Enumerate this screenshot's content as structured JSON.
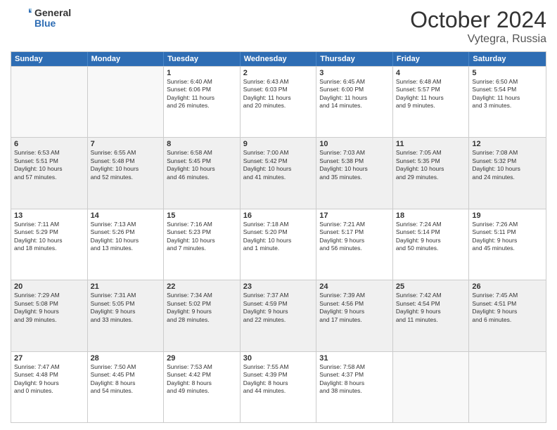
{
  "logo": {
    "general": "General",
    "blue": "Blue"
  },
  "title": "October 2024",
  "location": "Vytegra, Russia",
  "days": [
    "Sunday",
    "Monday",
    "Tuesday",
    "Wednesday",
    "Thursday",
    "Friday",
    "Saturday"
  ],
  "weeks": [
    [
      {
        "num": "",
        "lines": [],
        "empty": true
      },
      {
        "num": "",
        "lines": [],
        "empty": true
      },
      {
        "num": "1",
        "lines": [
          "Sunrise: 6:40 AM",
          "Sunset: 6:06 PM",
          "Daylight: 11 hours",
          "and 26 minutes."
        ]
      },
      {
        "num": "2",
        "lines": [
          "Sunrise: 6:43 AM",
          "Sunset: 6:03 PM",
          "Daylight: 11 hours",
          "and 20 minutes."
        ]
      },
      {
        "num": "3",
        "lines": [
          "Sunrise: 6:45 AM",
          "Sunset: 6:00 PM",
          "Daylight: 11 hours",
          "and 14 minutes."
        ]
      },
      {
        "num": "4",
        "lines": [
          "Sunrise: 6:48 AM",
          "Sunset: 5:57 PM",
          "Daylight: 11 hours",
          "and 9 minutes."
        ]
      },
      {
        "num": "5",
        "lines": [
          "Sunrise: 6:50 AM",
          "Sunset: 5:54 PM",
          "Daylight: 11 hours",
          "and 3 minutes."
        ]
      }
    ],
    [
      {
        "num": "6",
        "lines": [
          "Sunrise: 6:53 AM",
          "Sunset: 5:51 PM",
          "Daylight: 10 hours",
          "and 57 minutes."
        ]
      },
      {
        "num": "7",
        "lines": [
          "Sunrise: 6:55 AM",
          "Sunset: 5:48 PM",
          "Daylight: 10 hours",
          "and 52 minutes."
        ]
      },
      {
        "num": "8",
        "lines": [
          "Sunrise: 6:58 AM",
          "Sunset: 5:45 PM",
          "Daylight: 10 hours",
          "and 46 minutes."
        ]
      },
      {
        "num": "9",
        "lines": [
          "Sunrise: 7:00 AM",
          "Sunset: 5:42 PM",
          "Daylight: 10 hours",
          "and 41 minutes."
        ]
      },
      {
        "num": "10",
        "lines": [
          "Sunrise: 7:03 AM",
          "Sunset: 5:38 PM",
          "Daylight: 10 hours",
          "and 35 minutes."
        ]
      },
      {
        "num": "11",
        "lines": [
          "Sunrise: 7:05 AM",
          "Sunset: 5:35 PM",
          "Daylight: 10 hours",
          "and 29 minutes."
        ]
      },
      {
        "num": "12",
        "lines": [
          "Sunrise: 7:08 AM",
          "Sunset: 5:32 PM",
          "Daylight: 10 hours",
          "and 24 minutes."
        ]
      }
    ],
    [
      {
        "num": "13",
        "lines": [
          "Sunrise: 7:11 AM",
          "Sunset: 5:29 PM",
          "Daylight: 10 hours",
          "and 18 minutes."
        ]
      },
      {
        "num": "14",
        "lines": [
          "Sunrise: 7:13 AM",
          "Sunset: 5:26 PM",
          "Daylight: 10 hours",
          "and 13 minutes."
        ]
      },
      {
        "num": "15",
        "lines": [
          "Sunrise: 7:16 AM",
          "Sunset: 5:23 PM",
          "Daylight: 10 hours",
          "and 7 minutes."
        ]
      },
      {
        "num": "16",
        "lines": [
          "Sunrise: 7:18 AM",
          "Sunset: 5:20 PM",
          "Daylight: 10 hours",
          "and 1 minute."
        ]
      },
      {
        "num": "17",
        "lines": [
          "Sunrise: 7:21 AM",
          "Sunset: 5:17 PM",
          "Daylight: 9 hours",
          "and 56 minutes."
        ]
      },
      {
        "num": "18",
        "lines": [
          "Sunrise: 7:24 AM",
          "Sunset: 5:14 PM",
          "Daylight: 9 hours",
          "and 50 minutes."
        ]
      },
      {
        "num": "19",
        "lines": [
          "Sunrise: 7:26 AM",
          "Sunset: 5:11 PM",
          "Daylight: 9 hours",
          "and 45 minutes."
        ]
      }
    ],
    [
      {
        "num": "20",
        "lines": [
          "Sunrise: 7:29 AM",
          "Sunset: 5:08 PM",
          "Daylight: 9 hours",
          "and 39 minutes."
        ]
      },
      {
        "num": "21",
        "lines": [
          "Sunrise: 7:31 AM",
          "Sunset: 5:05 PM",
          "Daylight: 9 hours",
          "and 33 minutes."
        ]
      },
      {
        "num": "22",
        "lines": [
          "Sunrise: 7:34 AM",
          "Sunset: 5:02 PM",
          "Daylight: 9 hours",
          "and 28 minutes."
        ]
      },
      {
        "num": "23",
        "lines": [
          "Sunrise: 7:37 AM",
          "Sunset: 4:59 PM",
          "Daylight: 9 hours",
          "and 22 minutes."
        ]
      },
      {
        "num": "24",
        "lines": [
          "Sunrise: 7:39 AM",
          "Sunset: 4:56 PM",
          "Daylight: 9 hours",
          "and 17 minutes."
        ]
      },
      {
        "num": "25",
        "lines": [
          "Sunrise: 7:42 AM",
          "Sunset: 4:54 PM",
          "Daylight: 9 hours",
          "and 11 minutes."
        ]
      },
      {
        "num": "26",
        "lines": [
          "Sunrise: 7:45 AM",
          "Sunset: 4:51 PM",
          "Daylight: 9 hours",
          "and 6 minutes."
        ]
      }
    ],
    [
      {
        "num": "27",
        "lines": [
          "Sunrise: 7:47 AM",
          "Sunset: 4:48 PM",
          "Daylight: 9 hours",
          "and 0 minutes."
        ]
      },
      {
        "num": "28",
        "lines": [
          "Sunrise: 7:50 AM",
          "Sunset: 4:45 PM",
          "Daylight: 8 hours",
          "and 54 minutes."
        ]
      },
      {
        "num": "29",
        "lines": [
          "Sunrise: 7:53 AM",
          "Sunset: 4:42 PM",
          "Daylight: 8 hours",
          "and 49 minutes."
        ]
      },
      {
        "num": "30",
        "lines": [
          "Sunrise: 7:55 AM",
          "Sunset: 4:39 PM",
          "Daylight: 8 hours",
          "and 44 minutes."
        ]
      },
      {
        "num": "31",
        "lines": [
          "Sunrise: 7:58 AM",
          "Sunset: 4:37 PM",
          "Daylight: 8 hours",
          "and 38 minutes."
        ]
      },
      {
        "num": "",
        "lines": [],
        "empty": true
      },
      {
        "num": "",
        "lines": [],
        "empty": true
      }
    ]
  ]
}
